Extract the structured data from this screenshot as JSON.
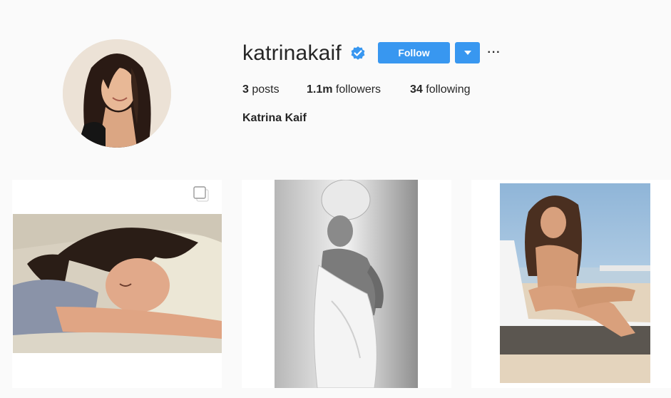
{
  "profile": {
    "username": "katrinakaif",
    "verified_icon": "verified-badge-icon",
    "follow_label": "Follow",
    "dropdown_icon": "triangle-down-icon",
    "more_label": "···",
    "full_name": "Katrina Kaif",
    "stats": {
      "posts_count": "3",
      "posts_label": "posts",
      "followers_count": "1.1m",
      "followers_label": "followers",
      "following_count": "34",
      "following_label": "following"
    }
  },
  "posts": [
    {
      "description": "woman sleeping on pillow",
      "multi": true
    },
    {
      "description": "black and white woman in towel",
      "multi": false
    },
    {
      "description": "woman sitting on beach lounger",
      "multi": false
    }
  ],
  "colors": {
    "accent": "#3897f0",
    "background": "#fafafa",
    "text": "#262626"
  }
}
